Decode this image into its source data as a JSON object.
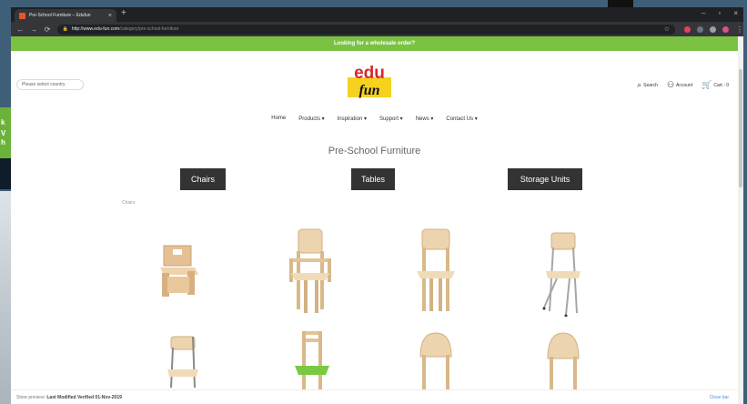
{
  "desktop": {
    "side_letters": [
      "k",
      "V",
      "h"
    ]
  },
  "browser": {
    "tab_title": "Pre-School Furniture – Edufun",
    "url_host": "http://www.edu-fun.com",
    "url_path": "/category/pre-school-furniture",
    "extension_colors": [
      "#e2435a",
      "#6c757d",
      "#9aa0a6",
      "#d84f8c"
    ]
  },
  "page": {
    "promo": "Looking for a wholesale order?",
    "country_select": "Please select country",
    "logo": {
      "top": "edu",
      "bottom": "fun"
    },
    "utils": {
      "search": "Search",
      "account": "Account",
      "cart": "Cart - 0"
    },
    "nav": [
      "Home",
      "Products ▾",
      "Inspiration ▾",
      "Support ▾",
      "News ▾",
      "Contact Us ▾"
    ],
    "heading": "Pre-School Furniture",
    "categories": [
      "Chairs",
      "Tables",
      "Storage Units"
    ],
    "section_label": "Chairs",
    "products": [
      {
        "style": "box-chair"
      },
      {
        "style": "arm-chair"
      },
      {
        "style": "wood-chair"
      },
      {
        "style": "metal-chair"
      },
      {
        "style": "metal-chair-short"
      },
      {
        "style": "green-seat-chair"
      },
      {
        "style": "round-back-chair"
      },
      {
        "style": "round-back-chair-2"
      }
    ],
    "cookie": {
      "prefix": "Store preview:",
      "bold": "Last Modified Verified 01-Nov-2019",
      "right": "Close bar"
    }
  }
}
